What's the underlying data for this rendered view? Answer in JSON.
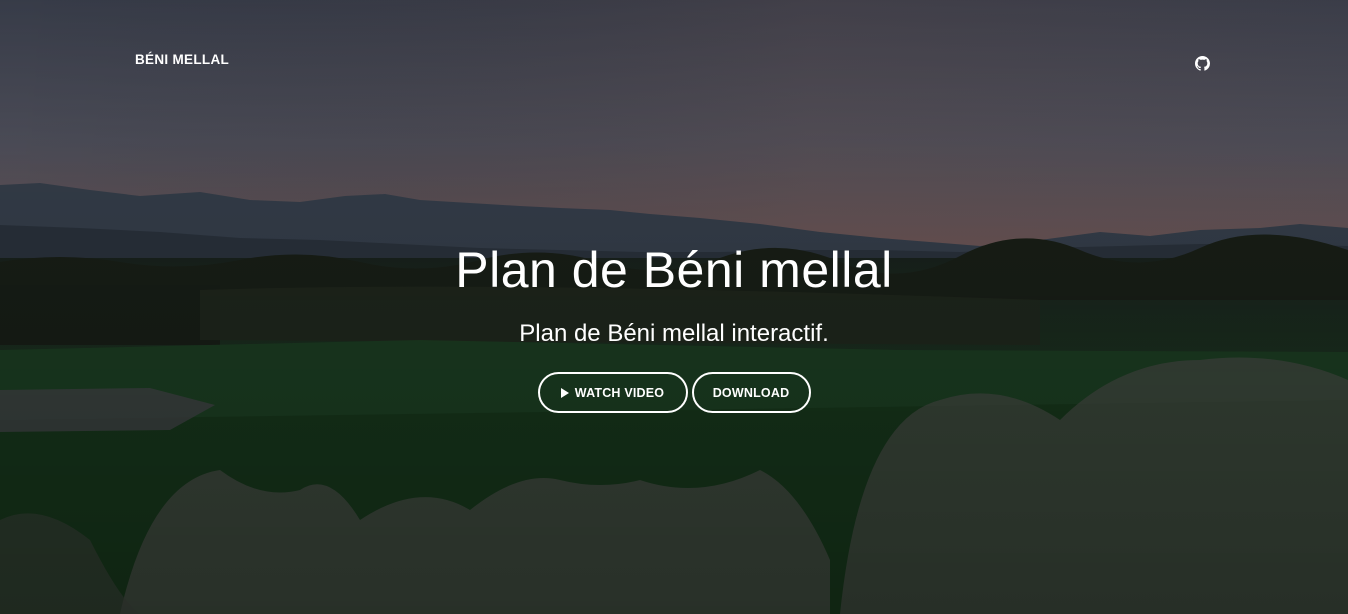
{
  "navbar": {
    "brand": "BÉNI MELLAL",
    "github_icon": "github-icon"
  },
  "hero": {
    "title": "Plan de Béni mellal",
    "subtitle": "Plan de Béni mellal interactif.",
    "buttons": {
      "watch_label": "WATCH VIDEO",
      "watch_icon": "play-icon",
      "download_label": "DOWNLOAD"
    }
  },
  "colors": {
    "sky_top": "#3f4452",
    "sky_horizon": "#7a5f5d",
    "field": "#1f3a22",
    "text": "#ffffff"
  }
}
